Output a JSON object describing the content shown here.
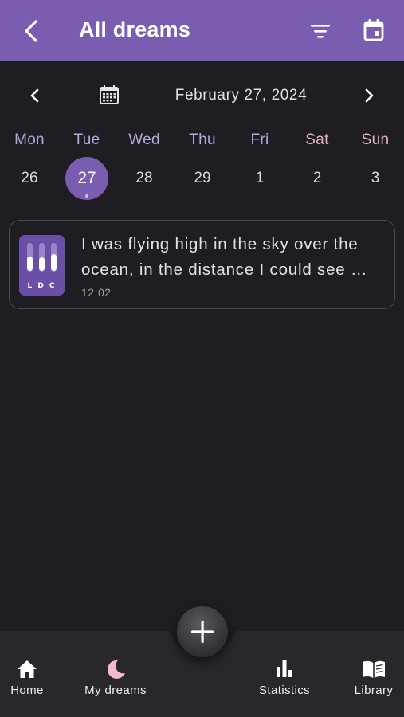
{
  "header": {
    "title": "All dreams",
    "back_icon": "chevron-left-icon",
    "filter_icon": "filter-icon",
    "calendar_icon": "calendar-icon",
    "background_color": "#7a5cb0"
  },
  "date_nav": {
    "current_date": "February 27, 2024",
    "prev_icon": "chevron-left-icon",
    "next_icon": "chevron-right-icon",
    "calendar_icon": "calendar-grid-icon"
  },
  "week": [
    {
      "name": "Mon",
      "number": "26",
      "name_color": "#b7a7dd",
      "selected": false
    },
    {
      "name": "Tue",
      "number": "27",
      "name_color": "#b7a7dd",
      "selected": true,
      "has_entry": true
    },
    {
      "name": "Wed",
      "number": "28",
      "name_color": "#b7a7dd",
      "selected": false
    },
    {
      "name": "Thu",
      "number": "29",
      "name_color": "#b7a7dd",
      "selected": false
    },
    {
      "name": "Fri",
      "number": "1",
      "name_color": "#b7a7dd",
      "selected": false
    },
    {
      "name": "Sat",
      "number": "2",
      "name_color": "#e3b3c2",
      "selected": false
    },
    {
      "name": "Sun",
      "number": "3",
      "name_color": "#e3b3c2",
      "selected": false
    }
  ],
  "dreams": [
    {
      "text_line1": "I was flying high in the sky over the",
      "text_line2": "ocean, in the distance I could see …",
      "time": "12:02",
      "icon": "ldc-app-icon",
      "icon_letters": "L D C"
    }
  ],
  "fab": {
    "icon": "plus-icon"
  },
  "bottom_nav": [
    {
      "label": "Home",
      "icon": "home-icon"
    },
    {
      "label": "My dreams",
      "icon": "moon-icon",
      "accent": "#f3b9cf"
    },
    {
      "label": "Statistics",
      "icon": "bar-chart-icon"
    },
    {
      "label": "Library",
      "icon": "book-icon"
    }
  ]
}
